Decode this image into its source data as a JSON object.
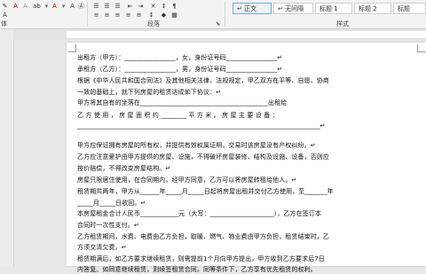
{
  "ribbon": {
    "font_group": "体",
    "paragraph_group": "段落",
    "styles_group": "样式",
    "styles": [
      "↵ 正文",
      "↵ 无间隔",
      "标题 1",
      "标题 2",
      "标题"
    ]
  },
  "document": {
    "lines": [
      "出租方（甲方）：________________，女，身份证号码________________↵",
      "承租方（乙方）：________________，男，身份证号码________________↵",
      "根据《中华人民共和国合同法》及其他相关法律、法规规定，甲乙双方在平等、自愿、协商",
      "一致的基础上，就下列房屋的租赁达成如下协议：↵",
      "甲方将其自有的坐落在________________________________________出租给",
      "乙 方 使 用 ， 房 屋 面 积 约 ________ 平 方 米 。 房 屋 主 要 设 备 ：",
      "____________________________________________________________________________↵",
      "甲方应保证拥有房屋的所有权，并提供有效权属证明，交易时该房屋没有产权纠纷。↵",
      "乙方应注意爱护由甲方提供的房屋、设施，不得破坏房屋装修、结构及设施、设备，否则应",
      "按价赔偿，不得改变房屋结构。↵",
      "房屋只限居住使用，在合同期内，经甲方同意，乙方可以将房屋转租给他人。↵",
      "租赁期共两年，甲方从______年_____月_____日起将房屋出租并交付乙方使用，至_______年",
      "_____月_____日收回。↵",
      "本房屋租金合计人民币____________元（大写：____________________），乙方在签订本",
      "合同时一次性支付。↵",
      "乙方租赁期间，水费、电费由乙方负担，取暖、燃气、物业费由甲方负担，租赁结束时，乙",
      "方须交清欠费。↵",
      "租赁期满后，如乙方要求继续租赁，则需提前1个月向甲方提出，甲方收到乙方要求后7日",
      "内答复。如同意继续租赁，则续签租赁合同。同等条件下，乙方享有优先租赁的权利。"
    ]
  }
}
